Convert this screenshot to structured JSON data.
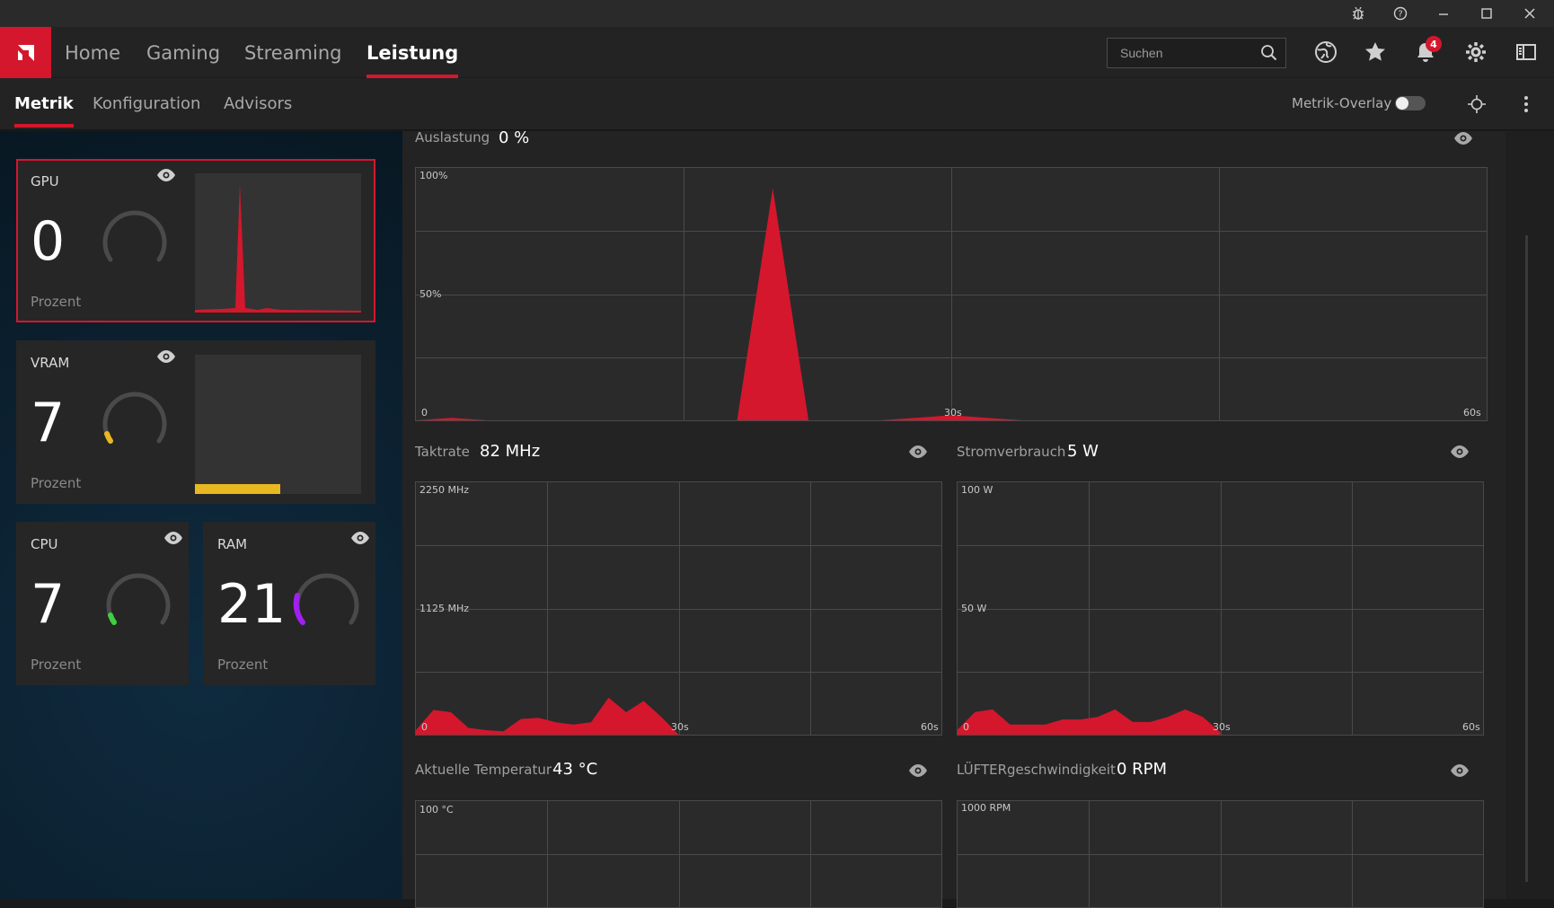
{
  "colors": {
    "accent": "#d4172c",
    "vram": "#e8b820",
    "cpu": "#3fcf3f",
    "ram": "#a020f0"
  },
  "window": {
    "controls": [
      "bug-icon",
      "help-icon",
      "minimize-icon",
      "maximize-icon",
      "close-icon"
    ]
  },
  "nav": {
    "tabs": [
      "Home",
      "Gaming",
      "Streaming",
      "Leistung"
    ],
    "active": "Leistung",
    "search_placeholder": "Suchen",
    "notification_count": "4"
  },
  "subnav": {
    "tabs": [
      "Metrik",
      "Konfiguration",
      "Advisors"
    ],
    "active": "Metrik",
    "overlay_label": "Metrik-Overlay",
    "overlay_enabled": false
  },
  "cards": {
    "gpu": {
      "title": "GPU",
      "value": "0",
      "unit": "Prozent",
      "gauge_fraction": 0.0
    },
    "vram": {
      "title": "VRAM",
      "value": "7",
      "unit": "Prozent",
      "gauge_fraction": 0.07
    },
    "cpu": {
      "title": "CPU",
      "value": "7",
      "unit": "Prozent",
      "gauge_fraction": 0.07
    },
    "ram": {
      "title": "RAM",
      "value": "21",
      "unit": "Prozent",
      "gauge_fraction": 0.21
    }
  },
  "metrics": {
    "auslastung": {
      "label": "Auslastung",
      "value": "0 %",
      "y_top": "100%",
      "y_mid": "50%",
      "y_zero": "0",
      "x_mid": "30s",
      "x_end": "60s"
    },
    "taktrate": {
      "label": "Taktrate",
      "value": "82 MHz",
      "y_top": "2250 MHz",
      "y_mid": "1125 MHz",
      "y_zero": "0",
      "x_mid": "30s",
      "x_end": "60s"
    },
    "strom": {
      "label": "Stromverbrauch",
      "value": "5 W",
      "y_top": "100 W",
      "y_mid": "50 W",
      "y_zero": "0",
      "x_mid": "30s",
      "x_end": "60s"
    },
    "temp": {
      "label": "Aktuelle Temperatur",
      "value": "43 °C",
      "y_top": "100 °C"
    },
    "fan": {
      "label": "LÜFTERgeschwindigkeit",
      "value": "0 RPM",
      "y_top": "1000 RPM"
    }
  },
  "chart_data": [
    {
      "type": "area",
      "title": "Auslastung",
      "x": [
        0,
        2,
        4,
        6,
        8,
        10,
        12,
        14,
        16,
        18,
        20,
        22,
        24,
        26,
        28,
        30,
        32,
        34,
        36,
        38,
        40,
        42,
        44,
        46,
        48,
        50,
        52,
        54,
        56,
        58,
        60
      ],
      "series": [
        {
          "values": [
            0,
            1,
            0,
            0,
            0,
            0,
            0,
            0,
            0,
            0,
            92,
            0,
            0,
            0,
            1,
            2,
            1,
            0,
            0,
            0,
            0,
            0,
            0,
            0,
            0,
            0,
            0,
            0,
            0,
            0,
            0
          ]
        }
      ],
      "ylim": [
        0,
        100
      ],
      "xlim": [
        0,
        60
      ]
    },
    {
      "type": "area",
      "title": "Taktrate",
      "x": [
        0,
        2,
        4,
        6,
        8,
        10,
        12,
        14,
        16,
        18,
        20,
        22,
        24,
        26,
        28,
        30
      ],
      "series": [
        {
          "values": [
            40,
            220,
            200,
            60,
            40,
            30,
            140,
            150,
            110,
            90,
            110,
            330,
            200,
            300,
            160,
            0
          ]
        }
      ],
      "ylim": [
        0,
        2250
      ],
      "xlim": [
        0,
        60
      ]
    },
    {
      "type": "area",
      "title": "Stromverbrauch",
      "x": [
        0,
        2,
        4,
        6,
        8,
        10,
        12,
        14,
        16,
        18,
        20,
        22,
        24,
        26,
        28,
        30
      ],
      "series": [
        {
          "values": [
            2,
            9,
            10,
            4,
            4,
            4,
            6,
            6,
            7,
            10,
            5,
            5,
            7,
            10,
            7,
            1
          ]
        }
      ],
      "ylim": [
        0,
        100
      ],
      "xlim": [
        0,
        60
      ]
    }
  ]
}
